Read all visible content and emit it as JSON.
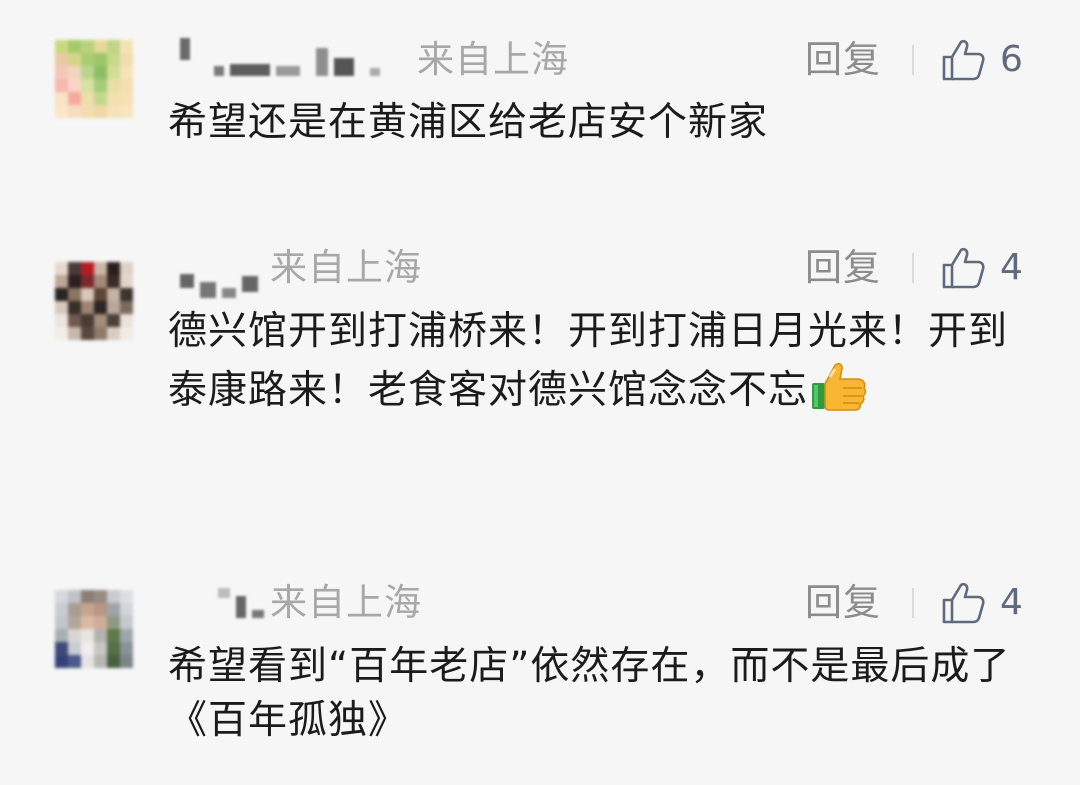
{
  "comments": [
    {
      "location": "来自上海",
      "reply_label": "回复",
      "like_count": "6",
      "text": "希望还是在黄浦区给老店安个新家",
      "emoji": ""
    },
    {
      "location": "来自上海",
      "reply_label": "回复",
      "like_count": "4",
      "text": "德兴馆开到打浦桥来！开到打浦日月光来！开到泰康路来！老食客对德兴馆念念不忘",
      "emoji": "thumbs-up-icon"
    },
    {
      "location": "来自上海",
      "reply_label": "回复",
      "like_count": "4",
      "text": "希望看到“百年老店”依然存在，而不是最后成了《百年孤独》",
      "emoji": ""
    }
  ],
  "colors": {
    "background": "#f6f6f6",
    "text": "#1b1b1b",
    "location": "#a8a8a8",
    "reply": "#8c8c8c",
    "like_icon": "#5f6b7c"
  }
}
